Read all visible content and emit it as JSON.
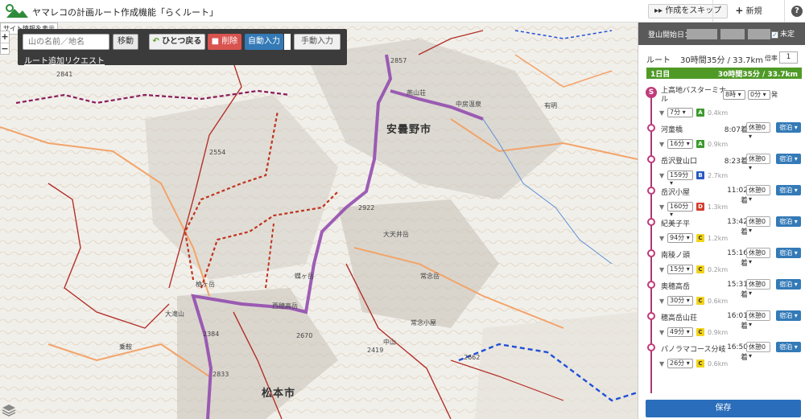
{
  "header": {
    "title": "ヤマレコの計画ルート作成機能「らくルート」",
    "skip_label": "作成をスキップ",
    "new_tab_label": "新規",
    "help_label": "?"
  },
  "map": {
    "site_info": "サイト情報を表示",
    "search_placeholder": "山の名前／地名",
    "move_label": "移動",
    "request_link": "ルート追加リクエスト",
    "undo_label": "ひとつ戻る",
    "delete_label": "削除",
    "auto_label": "自動入力",
    "manual_label": "手動入力",
    "zoom_in": "+",
    "zoom_out": "−",
    "places": {
      "azumino": "安曇野市",
      "matsumoto": "松本市"
    },
    "labels": [
      "有明",
      "中房温泉",
      "槍ヶ岳",
      "大天井岳",
      "常念岳",
      "蝶ヶ岳",
      "2662",
      "2857",
      "2922",
      "2554",
      "2841",
      "2670",
      "2384",
      "2833",
      "常念小屋",
      "西穂高岳",
      "中山",
      "2419",
      "乗鞍",
      "大滝山",
      "燕山荘"
    ]
  },
  "panel": {
    "start_label": "登山開始日：",
    "undecided_label": "未定",
    "undecided_checked": true,
    "route_label": "ルート",
    "route_total": "30時間35分 / 33.7km",
    "multiplier_label": "倍率",
    "multiplier_value": "1",
    "day_label": "1日目",
    "day_total": "30時間35分 / 33.7km",
    "start_point": {
      "name": "上高地バスターミナル",
      "hour": "8時",
      "minute": "0分",
      "depart": "発",
      "icon": "S"
    },
    "segments": [
      {
        "duration": "7分",
        "grade": "A",
        "distance": "0.4km"
      },
      {
        "duration": "16分",
        "grade": "A",
        "distance": "0.9km"
      },
      {
        "duration": "159分",
        "grade": "B",
        "distance": "2.7km"
      },
      {
        "duration": "160分",
        "grade": "D",
        "distance": "1.3km"
      },
      {
        "duration": "94分",
        "grade": "C",
        "distance": "1.2km"
      },
      {
        "duration": "15分",
        "grade": "C",
        "distance": "0.2km"
      },
      {
        "duration": "30分",
        "grade": "C",
        "distance": "0.6km"
      },
      {
        "duration": "49分",
        "grade": "C",
        "distance": "0.9km"
      },
      {
        "duration": "26分",
        "grade": "C",
        "distance": "0.6km"
      }
    ],
    "waypoints": [
      {
        "name": "河童橋",
        "time": "8:07着",
        "rest": "休憩0",
        "stay": "宿泊"
      },
      {
        "name": "岳沢登山口",
        "time": "8:23着",
        "rest": "休憩0",
        "stay": "宿泊"
      },
      {
        "name": "岳沢小屋",
        "time": "11:02着",
        "rest": "休憩0",
        "stay": "宿泊"
      },
      {
        "name": "紀美子平",
        "time": "13:42着",
        "rest": "休憩0",
        "stay": "宿泊"
      },
      {
        "name": "南稜ノ頭",
        "time": "15:16着",
        "rest": "休憩0",
        "stay": "宿泊"
      },
      {
        "name": "奥穂高岳",
        "time": "15:31着",
        "rest": "休憩0",
        "stay": "宿泊"
      },
      {
        "name": "穂高岳山荘",
        "time": "16:01着",
        "rest": "休憩0",
        "stay": "宿泊"
      },
      {
        "name": "パノラマコース分岐",
        "time": "16:50着",
        "rest": "休憩0",
        "stay": "宿泊"
      }
    ],
    "save_label": "保存",
    "colors": {
      "grade_A": "#3b9a2b",
      "grade_B": "#2a58c4",
      "grade_C": "#f2d31b",
      "grade_D": "#d43b2b",
      "route": "#8e44ad",
      "accent": "#337ab7"
    }
  }
}
